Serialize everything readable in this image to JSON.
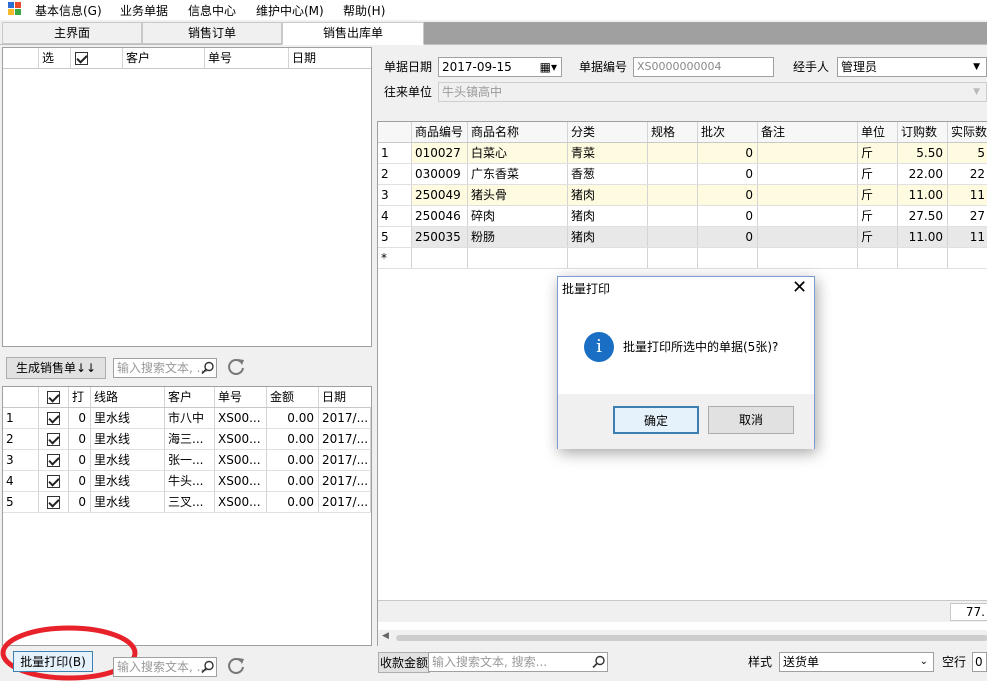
{
  "menu": {
    "items": [
      "基本信息(G)",
      "业务单据",
      "信息中心",
      "维护中心(M)",
      "帮助(H)"
    ]
  },
  "tabs": [
    "主界面",
    "销售订单",
    "销售出库单"
  ],
  "top_left_grid": {
    "headers": [
      "选",
      "客户",
      "单号",
      "日期"
    ]
  },
  "left_toolbar": {
    "generate_button": "生成销售单↓↓",
    "search_placeholder": "输入搜索文本, ..."
  },
  "bottom_left_grid": {
    "headers": [
      "打",
      "线路",
      "客户",
      "单号",
      "金额",
      "日期"
    ],
    "rows": [
      {
        "no": "1",
        "checked": true,
        "print": "0",
        "route": "里水线",
        "customer": "市八中",
        "order": "XS00...",
        "amount": "0.00",
        "date": "2017/..."
      },
      {
        "no": "2",
        "checked": true,
        "print": "0",
        "route": "里水线",
        "customer": "海三...",
        "order": "XS00...",
        "amount": "0.00",
        "date": "2017/..."
      },
      {
        "no": "3",
        "checked": true,
        "print": "0",
        "route": "里水线",
        "customer": "张一...",
        "order": "XS00...",
        "amount": "0.00",
        "date": "2017/..."
      },
      {
        "no": "4",
        "checked": true,
        "print": "0",
        "route": "里水线",
        "customer": "牛头...",
        "order": "XS00...",
        "amount": "0.00",
        "date": "2017/..."
      },
      {
        "no": "5",
        "checked": true,
        "print": "0",
        "route": "里水线",
        "customer": "三叉...",
        "order": "XS00...",
        "amount": "0.00",
        "date": "2017/..."
      }
    ]
  },
  "bottom_left_toolbar": {
    "batch_print_button": "批量打印(B)",
    "search_placeholder": "输入搜索文本, ..."
  },
  "form": {
    "date_label": "单据日期",
    "date_value": "2017-09-15",
    "number_label": "单据编号",
    "number_value": "XS0000000004",
    "handler_label": "经手人",
    "handler_value": "管理员",
    "partner_label": "往来单位",
    "partner_value": "牛头镇高中"
  },
  "detail_grid": {
    "headers": [
      "商品编号",
      "商品名称",
      "分类",
      "规格",
      "批次",
      "备注",
      "单位",
      "订购数",
      "实际数"
    ],
    "rows": [
      {
        "no": "1",
        "code": "010027",
        "name": "白菜心",
        "category": "青菜",
        "spec": "",
        "batch": "0",
        "note": "",
        "unit": "斤",
        "ordered": "5.50",
        "actual": "5"
      },
      {
        "no": "2",
        "code": "030009",
        "name": "广东香菜",
        "category": "香葱",
        "spec": "",
        "batch": "0",
        "note": "",
        "unit": "斤",
        "ordered": "22.00",
        "actual": "22"
      },
      {
        "no": "3",
        "code": "250049",
        "name": "猪头骨",
        "category": "猪肉",
        "spec": "",
        "batch": "0",
        "note": "",
        "unit": "斤",
        "ordered": "11.00",
        "actual": "11"
      },
      {
        "no": "4",
        "code": "250046",
        "name": "碎肉",
        "category": "猪肉",
        "spec": "",
        "batch": "0",
        "note": "",
        "unit": "斤",
        "ordered": "27.50",
        "actual": "27"
      },
      {
        "no": "5",
        "code": "250035",
        "name": "粉肠",
        "category": "猪肉",
        "spec": "",
        "batch": "0",
        "note": "",
        "unit": "斤",
        "ordered": "11.00",
        "actual": "11"
      }
    ],
    "new_row_marker": "*",
    "total": "77."
  },
  "bottom_right_toolbar": {
    "amount_button": "收款金额",
    "search_placeholder": "输入搜索文本, 搜索...",
    "style_label": "样式",
    "style_value": "送货单",
    "blank_label": "空行",
    "blank_value": "0"
  },
  "dialog": {
    "title": "批量打印",
    "message": "批量打印所选中的单据(5张)?",
    "ok": "确定",
    "cancel": "取消",
    "info_icon_glyph": "i"
  },
  "colors": {
    "highlight_row": "#fffbe0",
    "annotation_red": "#e8222a",
    "info_blue": "#1a6fc4"
  }
}
